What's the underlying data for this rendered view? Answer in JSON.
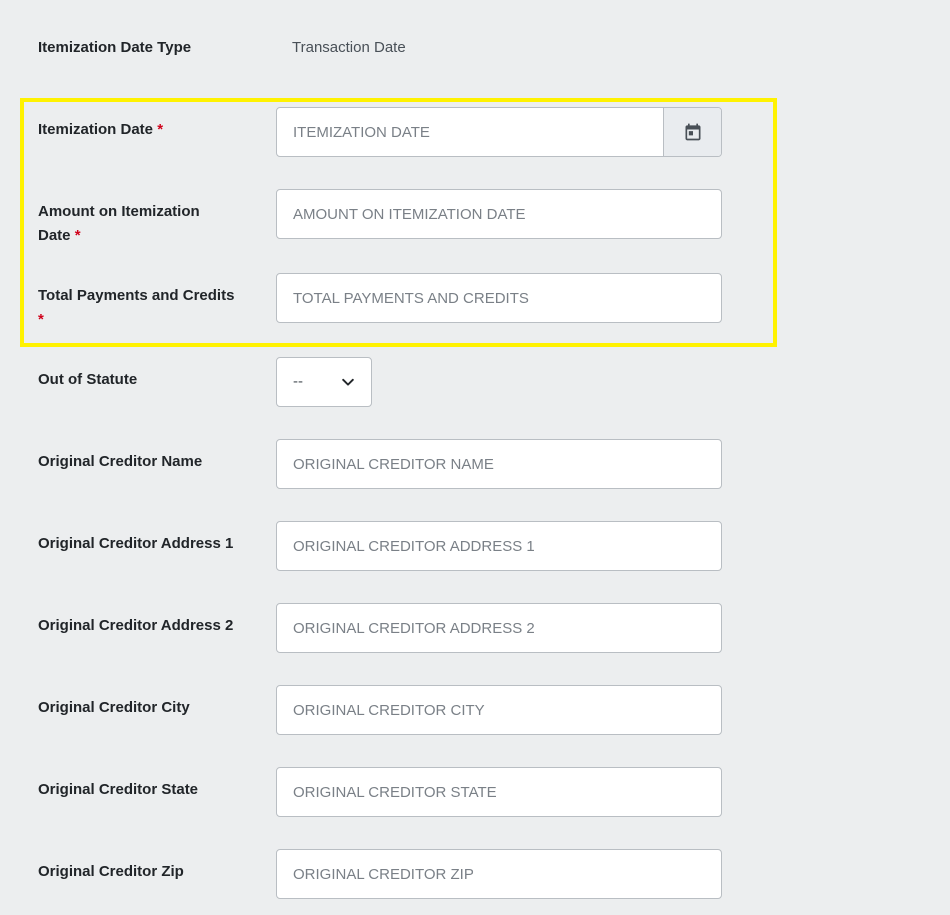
{
  "fields": {
    "itemization_date_type": {
      "label": "Itemization Date Type",
      "value": "Transaction Date"
    },
    "itemization_date": {
      "label": "Itemization Date",
      "required_mark": "*",
      "placeholder": "ITEMIZATION DATE",
      "button_icon": "calendar-icon"
    },
    "amount_on_itemization_date": {
      "label_line1": "Amount on Itemization",
      "label_line2": "Date",
      "required_mark": "*",
      "placeholder": "AMOUNT ON ITEMIZATION DATE"
    },
    "total_payments_and_credits": {
      "label": "Total Payments and Credits",
      "required_mark": "*",
      "placeholder": "TOTAL PAYMENTS AND CREDITS"
    },
    "out_of_statute": {
      "label": "Out of Statute",
      "selected": "--",
      "icon": "chevron-down-icon"
    },
    "original_creditor_name": {
      "label": "Original Creditor Name",
      "placeholder": "ORIGINAL CREDITOR NAME"
    },
    "original_creditor_address_1": {
      "label": "Original Creditor Address 1",
      "placeholder": "ORIGINAL CREDITOR ADDRESS 1"
    },
    "original_creditor_address_2": {
      "label": "Original Creditor Address 2",
      "placeholder": "ORIGINAL CREDITOR ADDRESS 2"
    },
    "original_creditor_city": {
      "label": "Original Creditor City",
      "placeholder": "ORIGINAL CREDITOR CITY"
    },
    "original_creditor_state": {
      "label": "Original Creditor State",
      "placeholder": "ORIGINAL CREDITOR STATE"
    },
    "original_creditor_zip": {
      "label": "Original Creditor Zip",
      "placeholder": "ORIGINAL CREDITOR ZIP"
    }
  },
  "colors": {
    "background": "#eceeef",
    "highlight_border": "#fff200",
    "required": "#d0021b",
    "input_border": "#b9bec3"
  }
}
